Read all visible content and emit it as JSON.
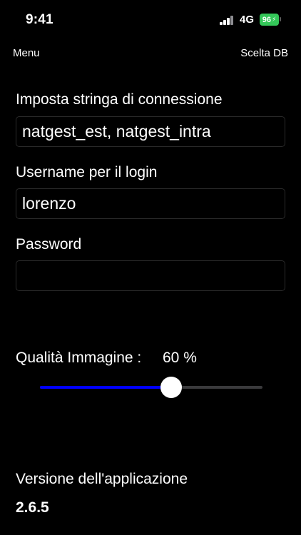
{
  "status_bar": {
    "time": "9:41",
    "network": "4G",
    "battery": "96",
    "battery_color": "#34c759"
  },
  "nav": {
    "left_label": "Menu",
    "right_label": "Scelta DB"
  },
  "form": {
    "connection_label": "Imposta stringa di connessione",
    "connection_value": "natgest_est, natgest_intra",
    "username_label": "Username per il login",
    "username_value": "lorenzo",
    "password_label": "Password",
    "password_value": ""
  },
  "quality": {
    "label": "Qualità Immagine :",
    "value_text": "60 %",
    "slider_fraction": 0.59,
    "fill_color": "#0000ff"
  },
  "version": {
    "label": "Versione dell'applicazione",
    "value": "2.6.5"
  }
}
